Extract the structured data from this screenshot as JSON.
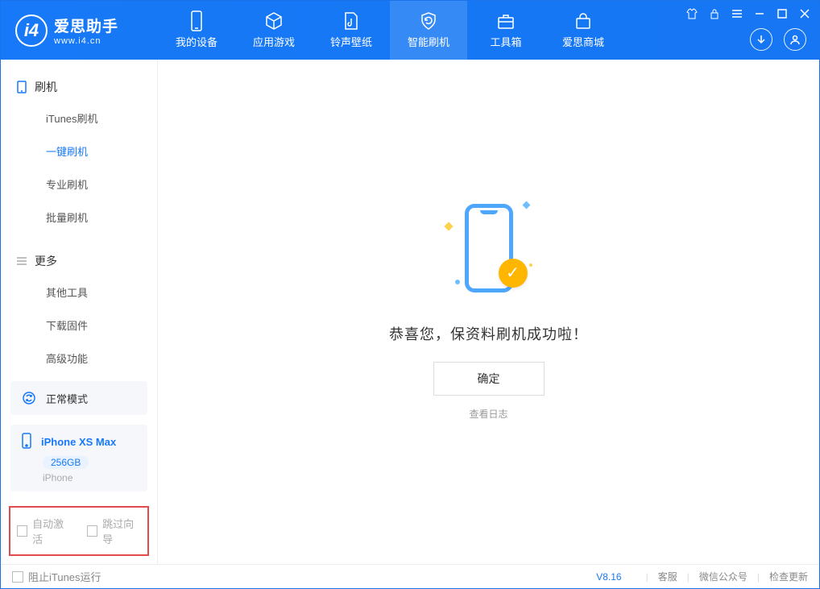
{
  "app": {
    "name_ch": "爱思助手",
    "name_en": "www.i4.cn"
  },
  "header_tabs": [
    {
      "label": "我的设备",
      "icon": "device-icon"
    },
    {
      "label": "应用游戏",
      "icon": "cube-icon"
    },
    {
      "label": "铃声壁纸",
      "icon": "music-file-icon"
    },
    {
      "label": "智能刷机",
      "icon": "refresh-shield-icon",
      "active": true
    },
    {
      "label": "工具箱",
      "icon": "toolbox-icon"
    },
    {
      "label": "爱思商城",
      "icon": "store-icon"
    }
  ],
  "sidebar": {
    "sections": [
      {
        "title": "刷机",
        "icon": "tablet-icon",
        "items": [
          {
            "label": "iTunes刷机"
          },
          {
            "label": "一键刷机",
            "active": true
          },
          {
            "label": "专业刷机"
          },
          {
            "label": "批量刷机"
          }
        ]
      },
      {
        "title": "更多",
        "icon": "menu-icon",
        "items": [
          {
            "label": "其他工具"
          },
          {
            "label": "下载固件"
          },
          {
            "label": "高级功能"
          }
        ]
      }
    ],
    "mode_card": {
      "label": "正常模式"
    },
    "device": {
      "name": "iPhone XS Max",
      "storage": "256GB",
      "type": "iPhone"
    },
    "highlight_options": {
      "opt1": "自动激活",
      "opt2": "跳过向导"
    }
  },
  "main": {
    "success_title": "恭喜您，保资料刷机成功啦！",
    "ok_button": "确定",
    "view_log": "查看日志"
  },
  "footer": {
    "block_itunes": "阻止iTunes运行",
    "version": "V8.16",
    "links": [
      "客服",
      "微信公众号",
      "检查更新"
    ]
  }
}
